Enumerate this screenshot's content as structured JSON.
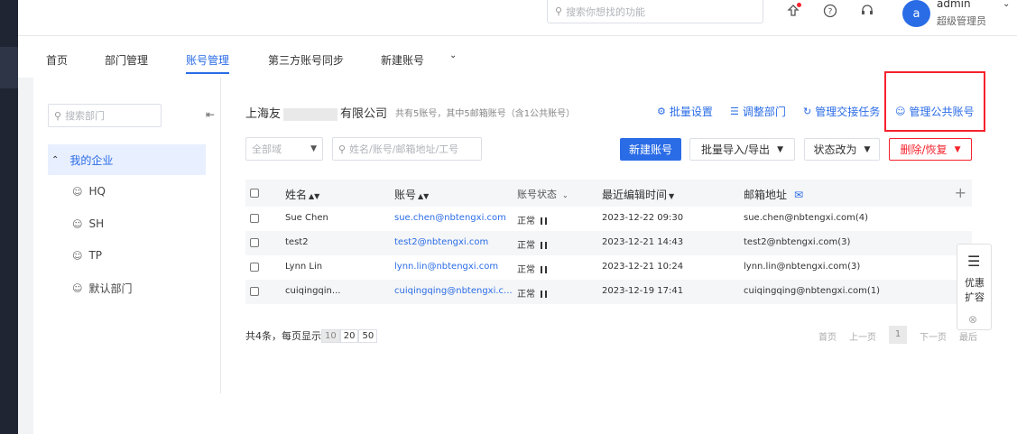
{
  "header": {
    "search_placeholder": "搜索你想找的功能",
    "user": {
      "avatar_letter": "a",
      "name": "admin",
      "role": "超级管理员"
    }
  },
  "nav": {
    "tabs": [
      {
        "label": "首页"
      },
      {
        "label": "部门管理"
      },
      {
        "label": "账号管理",
        "active": true
      },
      {
        "label": "第三方账号同步"
      },
      {
        "label": "新建账号"
      }
    ]
  },
  "sidebar": {
    "search_placeholder": "搜索部门",
    "root": "我的企业",
    "items": [
      {
        "label": "HQ"
      },
      {
        "label": "SH"
      },
      {
        "label": "TP"
      },
      {
        "label": "默认部门"
      }
    ]
  },
  "company": {
    "name_prefix": "上海友",
    "name_suffix": "有限公司",
    "summary": "共有5账号，其中5邮箱账号（含1公共账号）"
  },
  "actions": {
    "batch_settings": "批量设置",
    "adjust_dept": "调整部门",
    "handover": "管理交接任务",
    "manage_public": "管理公共账号"
  },
  "filters": {
    "dept_select": "全部域",
    "query_placeholder": "姓名/账号/邮箱地址/工号"
  },
  "buttons": {
    "new_account": "新建账号",
    "import_export": "批量导入/导出",
    "status_change": "状态改为",
    "delete_restore": "删除/恢复"
  },
  "table": {
    "headers": {
      "name": "姓名",
      "account": "账号",
      "status": "账号状态",
      "edited": "最近编辑时间",
      "mail": "邮箱地址"
    },
    "rows": [
      {
        "name": "Sue Chen",
        "account": "sue.chen@nbtengxi.com",
        "status": "正常",
        "edited": "2023-12-22 09:30",
        "mail": "sue.chen@nbtengxi.com",
        "count": "(4)"
      },
      {
        "name": "test2",
        "account": "test2@nbtengxi.com",
        "status": "正常",
        "edited": "2023-12-21 14:43",
        "mail": "test2@nbtengxi.com",
        "count": "(3)"
      },
      {
        "name": "Lynn Lin",
        "account": "lynn.lin@nbtengxi.com",
        "status": "正常",
        "edited": "2023-12-21 10:24",
        "mail": "lynn.lin@nbtengxi.com",
        "count": "(3)"
      },
      {
        "name": "cuiqingqin...",
        "account": "cuiqingqing@nbtengxi.c...",
        "status": "正常",
        "edited": "2023-12-19 17:41",
        "mail": "cuiqingqing@nbtengxi.com",
        "count": "(1)"
      }
    ]
  },
  "pagination": {
    "summary": "共4条，每页显示",
    "sizes": [
      "10",
      "20",
      "50"
    ],
    "first": "首页",
    "prev": "上一页",
    "current": "1",
    "next": "下一页",
    "last": "最后"
  },
  "promo": {
    "label": "优惠扩容"
  }
}
